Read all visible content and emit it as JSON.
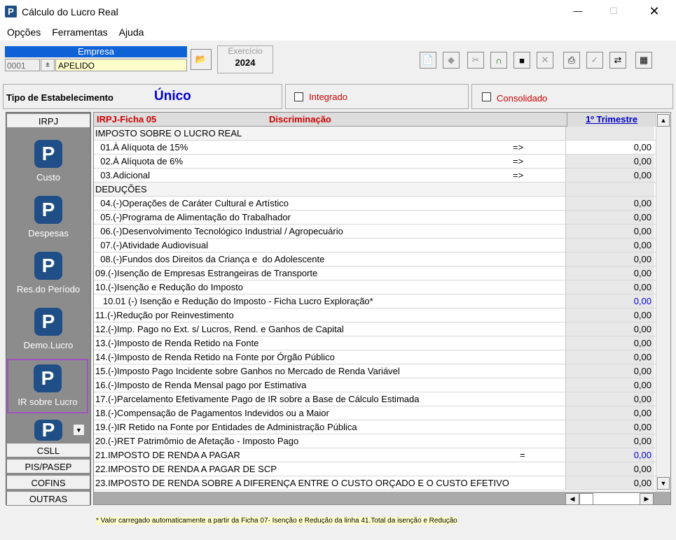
{
  "window": {
    "title": "Cálculo do Lucro Real"
  },
  "menu": [
    "Opções",
    "Ferramentas",
    "Ajuda"
  ],
  "empresa": {
    "label": "Empresa",
    "code": "0001",
    "name": "APELIDO"
  },
  "exercicio": {
    "label": "Exercício",
    "value": "2024"
  },
  "tipo": {
    "label": "Tipo de Estabelecimento",
    "value": "Único",
    "integrado": "Integrado",
    "consolidado": "Consolidado"
  },
  "sidebar": {
    "irpj": "IRPJ",
    "items": [
      "Custo",
      "Despesas",
      "Res.do Período",
      "Demo.Lucro",
      "IR sobre Lucro"
    ],
    "csll": "CSLL",
    "pis": "PIS/PASEP",
    "cofins": "COFINS",
    "outras": "OUTRAS"
  },
  "grid": {
    "col1": "IRPJ-Ficha 05",
    "col2": "Discriminação",
    "col3": "1º Trimestre"
  },
  "rows": [
    {
      "d": "IMPOSTO SOBRE O LUCRO REAL",
      "v": ""
    },
    {
      "d": "  01.À Alíquota de 15%",
      "a": "=>",
      "v": "0,00"
    },
    {
      "d": "  02.À Alíquota de 6%",
      "a": "=>",
      "v": "0,00"
    },
    {
      "d": "  03.Adicional",
      "a": "=>",
      "v": "0,00"
    },
    {
      "d": "DEDUÇÕES",
      "v": ""
    },
    {
      "d": "  04.(-)Operações de Caráter Cultural e Artístico",
      "v": "0,00"
    },
    {
      "d": "  05.(-)Programa de Alimentação do Trabalhador",
      "v": "0,00"
    },
    {
      "d": "  06.(-)Desenvolvimento Tecnológico Industrial / Agropecuário",
      "v": "0,00"
    },
    {
      "d": "  07.(-)Atividade Audiovisual",
      "v": "0,00"
    },
    {
      "d": "  08.(-)Fundos dos Direitos da Criança e  do Adolescente",
      "v": "0,00"
    },
    {
      "d": "09.(-)Isenção de Empresas Estrangeiras de Transporte",
      "v": "0,00"
    },
    {
      "d": "10.(-)Isenção e Redução do Imposto",
      "v": "0,00"
    },
    {
      "d": "   10.01 (-) Isenção e Redução do Imposto - Ficha Lucro Exploração*",
      "v": "0,00",
      "blue": true
    },
    {
      "d": "11.(-)Redução por Reinvestimento",
      "v": "0,00"
    },
    {
      "d": "12.(-)Imp. Pago no Ext. s/ Lucros, Rend. e Ganhos de Capital",
      "v": "0,00"
    },
    {
      "d": "13.(-)Imposto de Renda Retido na Fonte",
      "v": "0,00"
    },
    {
      "d": "14.(-)Imposto de Renda Retido na Fonte por Órgão Público",
      "v": "0,00"
    },
    {
      "d": "15.(-)Imposto Pago Incidente sobre Ganhos no Mercado de Renda Variável",
      "v": "0,00"
    },
    {
      "d": "16.(-)Imposto de Renda Mensal pago por Estimativa",
      "v": "0,00"
    },
    {
      "d": "17.(-)Parcelamento Efetivamente Pago de IR sobre a Base de Cálculo Estimada",
      "v": "0,00"
    },
    {
      "d": "18.(-)Compensação de Pagamentos Indevidos ou a Maior",
      "v": "0,00"
    },
    {
      "d": "19.(-)IR Retido na Fonte por Entidades de Administração Pública",
      "v": "0,00"
    },
    {
      "d": "20.(-)RET Patrimômio de Afetação - Imposto Pago",
      "v": "0,00"
    },
    {
      "d": "21.IMPOSTO DE RENDA A PAGAR",
      "a": "=",
      "v": "0,00",
      "blue": true
    },
    {
      "d": "22.IMPOSTO DE RENDA A PAGAR DE SCP",
      "v": "0,00"
    },
    {
      "d": "23.IMPOSTO DE RENDA SOBRE A DIFERENÇA ENTRE O CUSTO ORÇADO E O CUSTO EFETIVO",
      "v": "0,00"
    }
  ],
  "footnote": "* Valor carregado automaticamente a partir da Ficha 07- Isenção e Redução da linha 41.Total da isenção e Redução"
}
